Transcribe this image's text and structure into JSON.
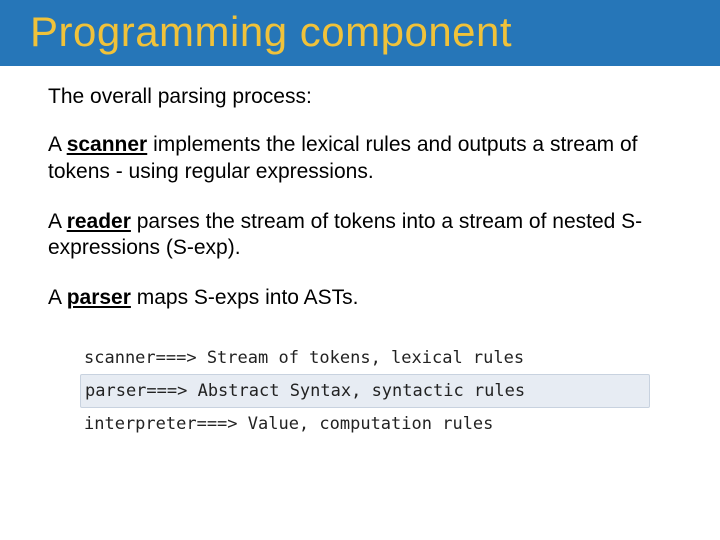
{
  "title": "Programming component",
  "intro": "The overall parsing process:",
  "paragraphs": [
    {
      "lead": "A ",
      "term": "scanner",
      "rest": " implements the lexical rules and outputs a stream of tokens - using regular expressions."
    },
    {
      "lead": "A ",
      "term": "reader",
      "rest": " parses the stream of tokens into a stream of nested S-expressions (S-exp)."
    },
    {
      "lead": "A ",
      "term": "parser",
      "rest": " maps S-exps into ASTs."
    }
  ],
  "code": [
    "scanner===> Stream of tokens, lexical rules",
    "parser===> Abstract Syntax, syntactic rules",
    "interpreter===> Value, computation rules"
  ]
}
